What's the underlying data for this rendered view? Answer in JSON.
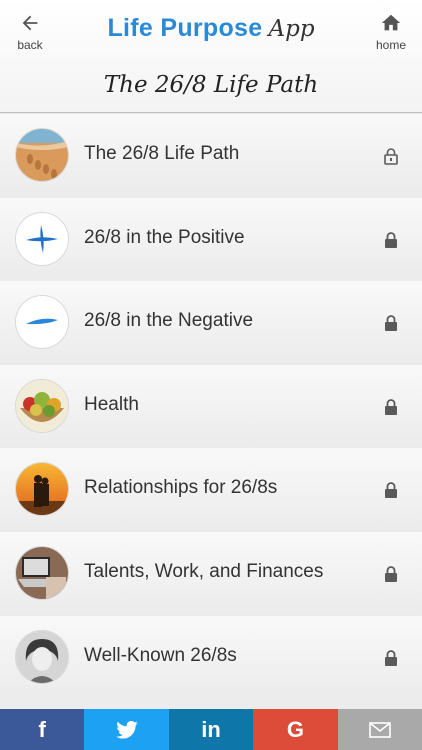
{
  "header": {
    "back_label": "back",
    "home_label": "home",
    "logo": {
      "part1": "Life Purpose",
      "part2": "App"
    },
    "title": "The 26/8 Life Path"
  },
  "list": {
    "items": [
      {
        "label": "The 26/8 Life Path",
        "thumb": "sand-footprints",
        "lock": "unlocked-lock-icon"
      },
      {
        "label": "26/8 in the Positive",
        "thumb": "blue-plus",
        "lock": "lock-icon"
      },
      {
        "label": "26/8 in the Negative",
        "thumb": "blue-minus",
        "lock": "lock-icon"
      },
      {
        "label": "Health",
        "thumb": "fruit-basket",
        "lock": "lock-icon"
      },
      {
        "label": "Relationships for 26/8s",
        "thumb": "sunset-couple",
        "lock": "lock-icon"
      },
      {
        "label": "Talents, Work, and Finances",
        "thumb": "laptop-desk",
        "lock": "lock-icon"
      },
      {
        "label": "Well-Known 26/8s",
        "thumb": "portrait-bw",
        "lock": "lock-icon"
      }
    ]
  },
  "share": {
    "facebook": {
      "glyph": "f",
      "color": "#3b5998"
    },
    "twitter": {
      "color": "#1da1f2"
    },
    "linkedin": {
      "glyph": "in",
      "color": "#0e76a8"
    },
    "google": {
      "glyph": "G",
      "color": "#dd4b39"
    },
    "email": {
      "color": "#a9a9a9"
    }
  }
}
